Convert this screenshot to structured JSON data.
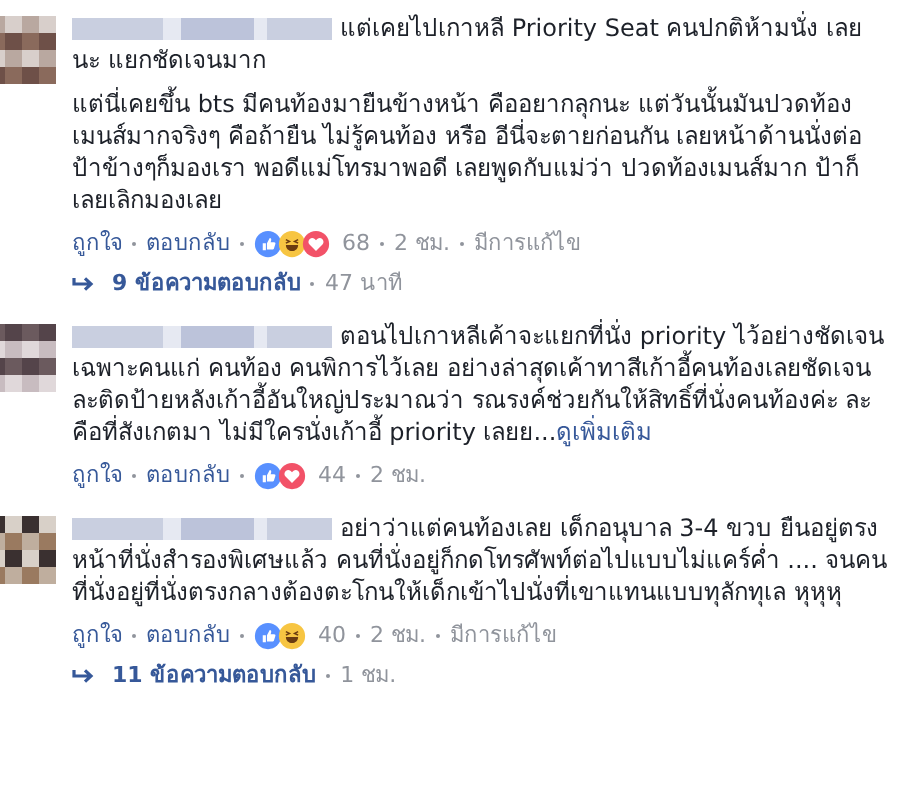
{
  "comments": [
    {
      "paragraphs": [
        "แต่เคยไปเกาหลี Priority Seat คนปกติห้ามนั่ง เลยนะ แยกชัดเจนมาก",
        "แต่นี่เคยขึ้น bts มีคนท้องมายืนข้างหน้า คืออยากลุกนะ แต่วันนั้นมันปวดท้องเมนส์มากจริงๆ คือถ้ายืน ไม่รู้คนท้อง หรือ อีนี่จะตายก่อนกัน เลยหน้าด้านนั่งต่อ ป้าข้างๆก็มองเรา พอดีแม่โทรมาพอดี เลยพูดกับแม่ว่า ปวดท้องเมนส์มาก ป้าก็เลยเลิกมองเลย"
      ],
      "like": "ถูกใจ",
      "reply": "ตอบกลับ",
      "reactions": [
        {
          "kind": "like"
        },
        {
          "kind": "haha"
        },
        {
          "kind": "love"
        }
      ],
      "count": "68",
      "time": "2 ชม.",
      "edited": "มีการแก้ไข",
      "replies": {
        "label": "9 ข้อความตอบกลับ",
        "time": "47 นาที"
      }
    },
    {
      "paragraphs": [
        "ตอนไปเกาหลีเค้าจะแยกที่นั่ง priority ไว้อย่างชัดเจน เฉพาะคนแก่ คนท้อง คนพิการไว้เลย อย่างล่าสุดเค้าทาสีเก้าอี้คนท้องเลยชัดเจน ละติดป้ายหลังเก้าอี้อันใหญ่ประมาณว่า รณรงค์ช่วยกันให้สิทธิ์ที่นั่งคนท้องค่ะ ละคือที่สังเกตมา ไม่มีใครนั่งเก้าอี้ priority เลยย..."
      ],
      "see_more": "ดูเพิ่มเติม",
      "like": "ถูกใจ",
      "reply": "ตอบกลับ",
      "reactions": [
        {
          "kind": "like"
        },
        {
          "kind": "love"
        }
      ],
      "count": "44",
      "time": "2 ชม."
    },
    {
      "paragraphs": [
        "อย่าว่าแต่คนท้องเลย เด็กอนุบาล 3-4 ขวบ ยืนอยู่ตรงหน้าที่นั่งสำรองพิเศษแล้ว คนที่นั่งอยู่ก็กดโทรศัพท์ต่อไปแบบไม่แคร์ค่ำ .... จนคนที่นั่งอยู่ที่นั่งตรงกลางต้องตะโกนให้เด็กเข้าไปนั่งที่เขาแทนแบบทุลักทุเล หุหุหุ"
      ],
      "like": "ถูกใจ",
      "reply": "ตอบกลับ",
      "reactions": [
        {
          "kind": "like"
        },
        {
          "kind": "haha"
        }
      ],
      "count": "40",
      "time": "2 ชม.",
      "edited": "มีการแก้ไข",
      "replies": {
        "label": "11 ข้อความตอบกลับ",
        "time": "1 ชม."
      }
    }
  ]
}
